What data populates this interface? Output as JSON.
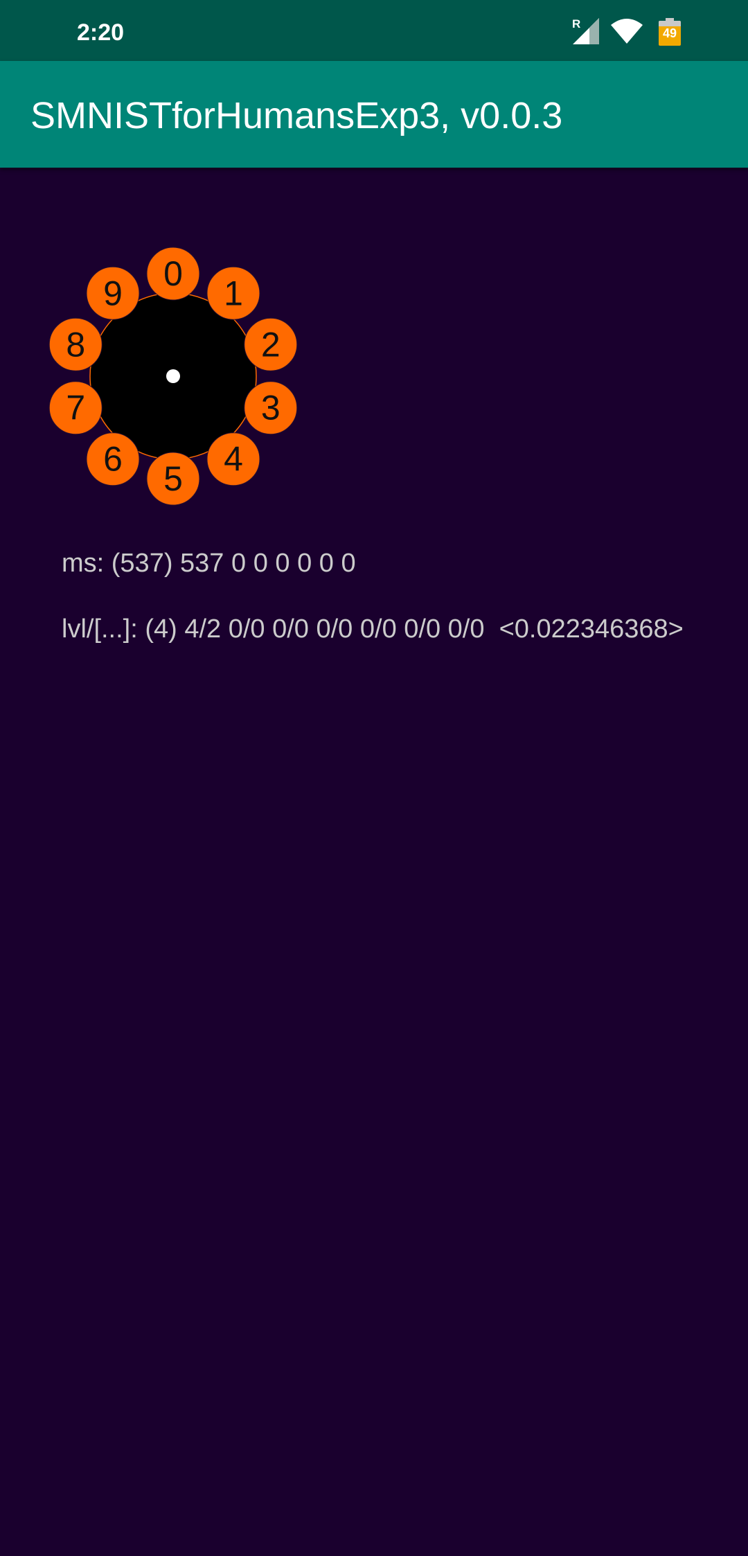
{
  "status_bar": {
    "time": "2:20",
    "signal_badge": "R",
    "battery_level": "49",
    "icons": [
      "signal-icon",
      "wifi-icon",
      "battery-icon"
    ]
  },
  "app_bar": {
    "title": "SMNISTforHumansExp3, v0.0.3"
  },
  "dial": {
    "digits": [
      "0",
      "1",
      "2",
      "3",
      "4",
      "5",
      "6",
      "7",
      "8",
      "9"
    ],
    "button_color": "#ff6a00",
    "center_color": "#000000"
  },
  "readouts": {
    "ms": "ms: (537) 537 0 0 0 0 0 0",
    "lvl": "lvl/[...]: (4) 4/2 0/0 0/0 0/0 0/0 0/0 0/0  <0.022346368>"
  },
  "colors": {
    "status_bar": "#00574b",
    "app_bar": "#008577",
    "background": "#1a002e",
    "readout_text": "#cccccc"
  }
}
